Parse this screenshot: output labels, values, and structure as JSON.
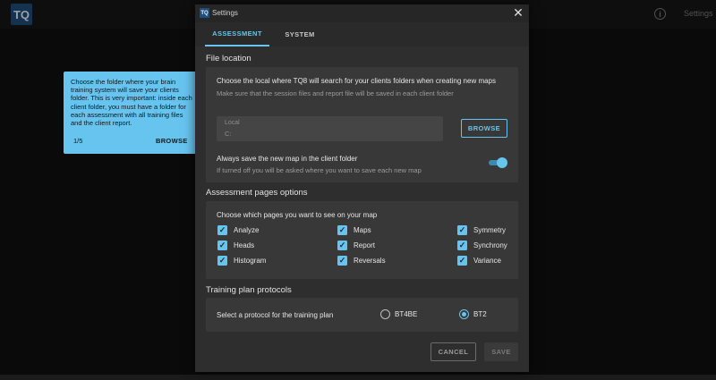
{
  "app": {
    "logo_text": "TQ",
    "top_settings": "Settings"
  },
  "dialog": {
    "logo_text": "TQ",
    "title": "Settings",
    "close_glyph": "✕",
    "tabs": [
      {
        "label": "ASSESSMENT",
        "active": true
      },
      {
        "label": "SYSTEM",
        "active": false
      }
    ],
    "file_location": {
      "title": "File location",
      "description": "Choose the local where TQ8 will search for your clients folders when creating new maps",
      "hint": "Make sure that the session files and report file will be saved in each client folder",
      "local_label": "Local",
      "local_value": "C:",
      "browse_label": "BROWSE",
      "always_save_title": "Always save the new map in the client folder",
      "always_save_hint": "If turned off you will be asked where you want to save each new map",
      "always_save_on": true
    },
    "pages_options": {
      "title": "Assessment pages options",
      "prompt": "Choose which pages you want to see on your map",
      "items": [
        {
          "label": "Analyze",
          "checked": true
        },
        {
          "label": "Heads",
          "checked": true
        },
        {
          "label": "Histogram",
          "checked": true
        },
        {
          "label": "Maps",
          "checked": true
        },
        {
          "label": "Report",
          "checked": true
        },
        {
          "label": "Reversals",
          "checked": true
        },
        {
          "label": "Symmetry",
          "checked": true
        },
        {
          "label": "Synchrony",
          "checked": true
        },
        {
          "label": "Variance",
          "checked": true
        }
      ]
    },
    "training": {
      "title": "Training plan protocols",
      "prompt": "Select a protocol for the training plan",
      "options": [
        {
          "label": "BT4BE",
          "selected": false
        },
        {
          "label": "BT2",
          "selected": true
        }
      ]
    },
    "cancel_label": "CANCEL",
    "save_label": "SAVE"
  },
  "tooltip": {
    "text": "Choose the folder where your brain training system will save your clients folder. This is very important: inside each client folder, you must have a folder for each assessment with all training files and the client report.",
    "step": "1/5",
    "action": "BROWSE"
  },
  "colors": {
    "accent": "#67c4ee",
    "dialog_bg": "#2e2e2e",
    "card_bg": "#383838"
  },
  "icons": {
    "info": "info-icon",
    "close": "close-icon",
    "check": "check-icon"
  }
}
